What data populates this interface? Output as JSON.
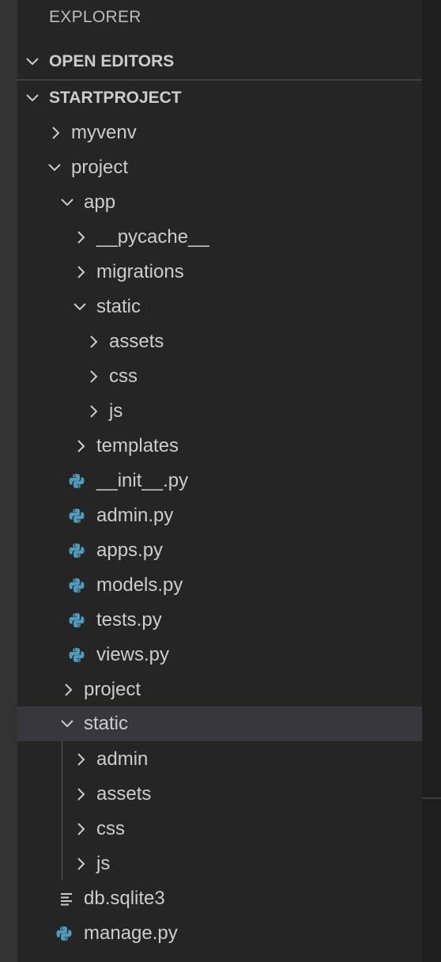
{
  "explorer": {
    "title": "EXPLORER"
  },
  "sections": {
    "open_editors": "OPEN EDITORS",
    "project_root": "STARTPROJECT"
  },
  "tree": {
    "myvenv": "myvenv",
    "project": "project",
    "app": "app",
    "pycache": "__pycache__",
    "migrations": "migrations",
    "app_static": "static",
    "app_static_assets": "assets",
    "app_static_css": "css",
    "app_static_js": "js",
    "templates": "templates",
    "init_py": "__init__.py",
    "admin_py": "admin.py",
    "apps_py": "apps.py",
    "models_py": "models.py",
    "tests_py": "tests.py",
    "views_py": "views.py",
    "inner_project": "project",
    "static": "static",
    "static_admin": "admin",
    "static_assets": "assets",
    "static_css": "css",
    "static_js": "js",
    "db_sqlite3": "db.sqlite3",
    "manage_py": "manage.py"
  },
  "icons": {
    "collapsed": "chevron-right-icon",
    "expanded": "chevron-down-icon",
    "python_file": "python-icon",
    "text_file": "lines-icon"
  },
  "colors": {
    "panel_bg": "#252526",
    "selected_row": "#37373d",
    "text": "#cccccc",
    "python_blue": "#519aba"
  }
}
